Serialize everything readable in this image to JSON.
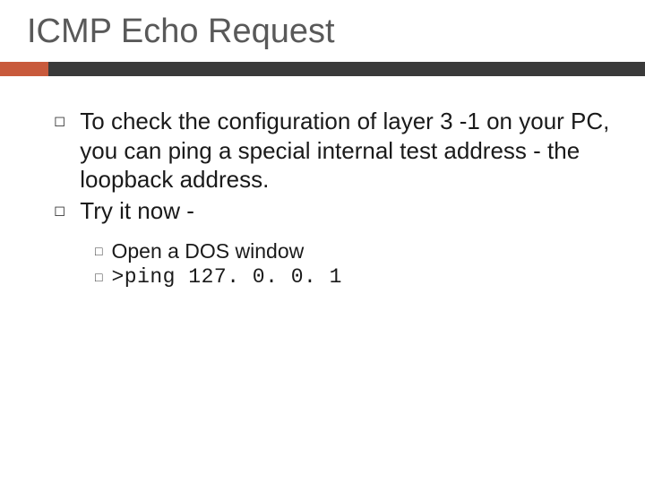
{
  "title": "ICMP Echo Request",
  "bullets": [
    "To check the configuration of layer 3 -1 on your PC, you can ping a special internal test address - the loopback address.",
    "Try it now -"
  ],
  "subs": [
    "Open a DOS window",
    ">ping 127. 0. 0. 1"
  ]
}
